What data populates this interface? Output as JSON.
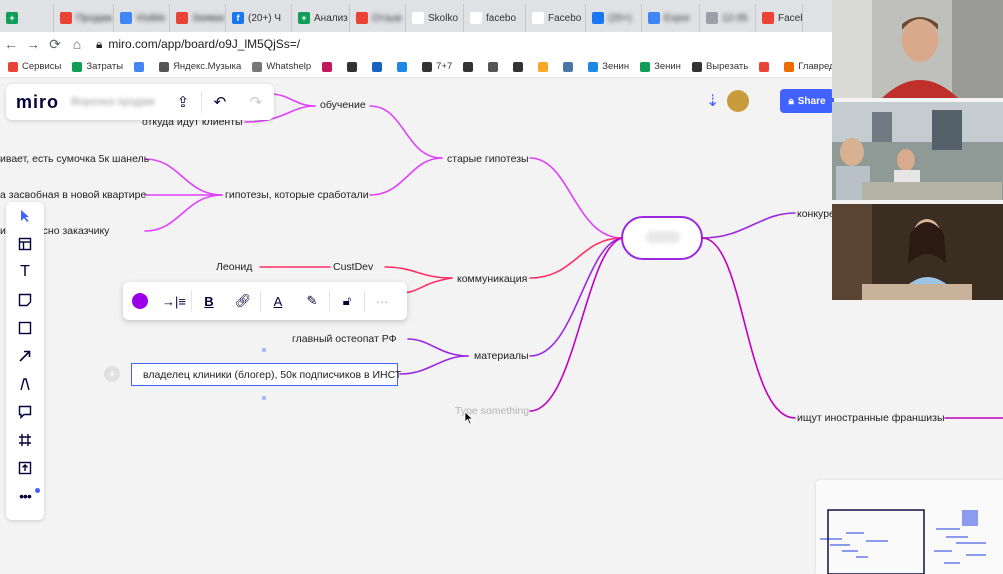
{
  "browser": {
    "tabs": [
      {
        "label": "",
        "color": "#0f9d58",
        "glyph": "+",
        "blurred": true
      },
      {
        "label": "Продаж",
        "color": "#ea4335",
        "glyph": "",
        "blurred": true
      },
      {
        "label": "Visible",
        "color": "#4285f4",
        "glyph": "",
        "blurred": true
      },
      {
        "label": "Заявки",
        "color": "#ea4335",
        "glyph": "",
        "blurred": true
      },
      {
        "label": "(20+) Ч",
        "color": "#1877f2",
        "glyph": "f",
        "blurred": false
      },
      {
        "label": "Анализ",
        "color": "#0f9d58",
        "glyph": "+",
        "blurred": false
      },
      {
        "label": "Отзыв",
        "color": "#ea4335",
        "glyph": "",
        "blurred": true
      },
      {
        "label": "Skolko",
        "color": "#ffffff",
        "glyph": "",
        "blurred": false
      },
      {
        "label": "facebo",
        "color": "#ffffff",
        "glyph": "G",
        "blurred": false
      },
      {
        "label": "Facebo",
        "color": "#ffffff",
        "glyph": "",
        "blurred": false
      },
      {
        "label": "(20+)",
        "color": "#1877f2",
        "glyph": "",
        "blurred": true
      },
      {
        "label": "Expor",
        "color": "#4285f4",
        "glyph": "",
        "blurred": true
      },
      {
        "label": "12-05",
        "color": "#9aa0a6",
        "glyph": "",
        "blurred": true
      },
      {
        "label": "Facebo",
        "color": "#ea4335",
        "glyph": "",
        "blurred": false
      }
    ],
    "url": "miro.com/app/board/o9J_lM5QjSs=/",
    "bookmarks": [
      {
        "label": "Сервисы",
        "color": "#ea4335"
      },
      {
        "label": "Затраты",
        "color": "#0f9d58"
      },
      {
        "label": "",
        "color": "#4285f4"
      },
      {
        "label": "Яндекс.Музыка",
        "color": "#555555"
      },
      {
        "label": "Whatshelp",
        "color": "#777777"
      },
      {
        "label": "",
        "color": "#c2185b"
      },
      {
        "label": "",
        "color": "#333333"
      },
      {
        "label": "",
        "color": "#1565c0"
      },
      {
        "label": "",
        "color": "#1e88e5"
      },
      {
        "label": "7+7",
        "color": "#333333"
      },
      {
        "label": "",
        "color": "#333333"
      },
      {
        "label": "",
        "color": "#555555"
      },
      {
        "label": "",
        "color": "#333333"
      },
      {
        "label": "",
        "color": "#f9a825"
      },
      {
        "label": "",
        "color": "#4a76a8"
      },
      {
        "label": "Зенин",
        "color": "#1e88e5"
      },
      {
        "label": "Зенин",
        "color": "#0f9d58"
      },
      {
        "label": "Вырезать",
        "color": "#333333"
      },
      {
        "label": "",
        "color": "#ea4335"
      },
      {
        "label": "Главред в",
        "color": "#ef6c00"
      }
    ]
  },
  "miro": {
    "logo": "miro",
    "board_name": "Воронка продаж",
    "share_label": "Share",
    "accent": "#4262ff",
    "branch_color": "#e040fb",
    "branch_color_2": "#c000c0",
    "branch_color_red": "#ff2e63",
    "branch_color_purple": "#9c27e0"
  },
  "mindmap": {
    "partial_left": "г",
    "obuchenie": "обучение",
    "otkuda": "откуда идут клиенты",
    "sumochka": "ивает, есть сумочка 5к шанель",
    "kvartira": "а засвобная в новой квартире",
    "zakazchiku": "и интересно заказчику",
    "gipotezy_rabotali": "гипотезы, которые сработали",
    "starye_gipotezy": "старые гипотезы",
    "leonid": "Леонид",
    "custdev": "CustDev",
    "kommunikacia": "коммуникация",
    "osteopat": "главный остеопат РФ",
    "materialy": "материалы",
    "editing_text": "владелец клиники (блогер), 50к подписчиков в ИНСТ",
    "type_something": "Type something",
    "konkurenty": "конкуре",
    "franshizy": "ищут иностранные франшизы"
  }
}
